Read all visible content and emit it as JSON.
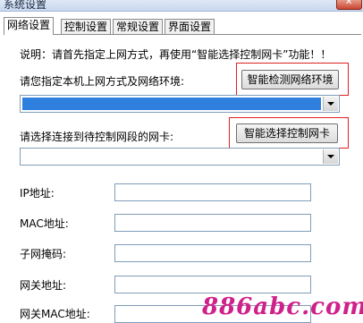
{
  "window": {
    "title": "系统设置",
    "close_glyph": "✕"
  },
  "tabs": [
    {
      "label": "网络设置",
      "active": true
    },
    {
      "label": "控制设置",
      "active": false
    },
    {
      "label": "常规设置",
      "active": false
    },
    {
      "label": "界面设置",
      "active": false
    }
  ],
  "notice": "说明：请首先指定上网方式，再使用“智能选择控制网卡”功能！！",
  "network": {
    "env_label": "请您指定本机上网方式及网络环境:",
    "detect_button": "智能检测网络环境",
    "env_value": "",
    "card_label": "请选择连接到待控制网段的网卡:",
    "select_card_button": "智能选择控制网卡",
    "card_value": ""
  },
  "fields": [
    {
      "label": "IP地址:",
      "value": ""
    },
    {
      "label": "MAC地址:",
      "value": ""
    },
    {
      "label": "子网掩码:",
      "value": ""
    },
    {
      "label": "网关地址:",
      "value": ""
    },
    {
      "label": "网关MAC地址:",
      "value": ""
    }
  ],
  "watermark": "886abc.com",
  "colors": {
    "highlight": "#2f7fde",
    "annotation_box": "#e02020",
    "watermark": "#d0208a"
  }
}
